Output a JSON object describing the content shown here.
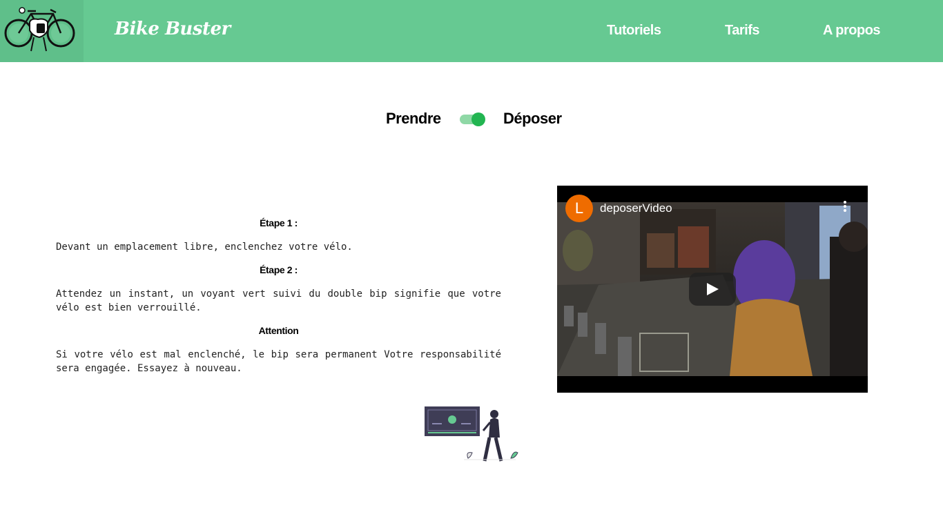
{
  "header": {
    "brand": "Bike Buster",
    "logo_icon": "bike-lock-logo-icon",
    "nav": [
      {
        "label": "Tutoriels"
      },
      {
        "label": "Tarifs"
      },
      {
        "label": "A propos"
      }
    ],
    "bg_color": "#66c992"
  },
  "toggle": {
    "left_label": "Prendre",
    "right_label": "Déposer",
    "state": "Déposer",
    "accent": "#22b551"
  },
  "steps": [
    {
      "heading": "Étape 1 :",
      "text": "Devant un emplacement libre, enclenchez votre vélo."
    },
    {
      "heading": "Étape 2 :",
      "text": "Attendez un instant, un voyant vert suivi du double bip signifie que votre vélo est bien verrouillé."
    },
    {
      "heading": "Attention",
      "text": "Si votre vélo est mal enclenché, le bip sera permanent Votre responsabilité sera engagée. Essayez à nouveau."
    }
  ],
  "video": {
    "channel_initial": "L",
    "title": "deposerVideo",
    "avatar_color": "#ef6c00"
  }
}
